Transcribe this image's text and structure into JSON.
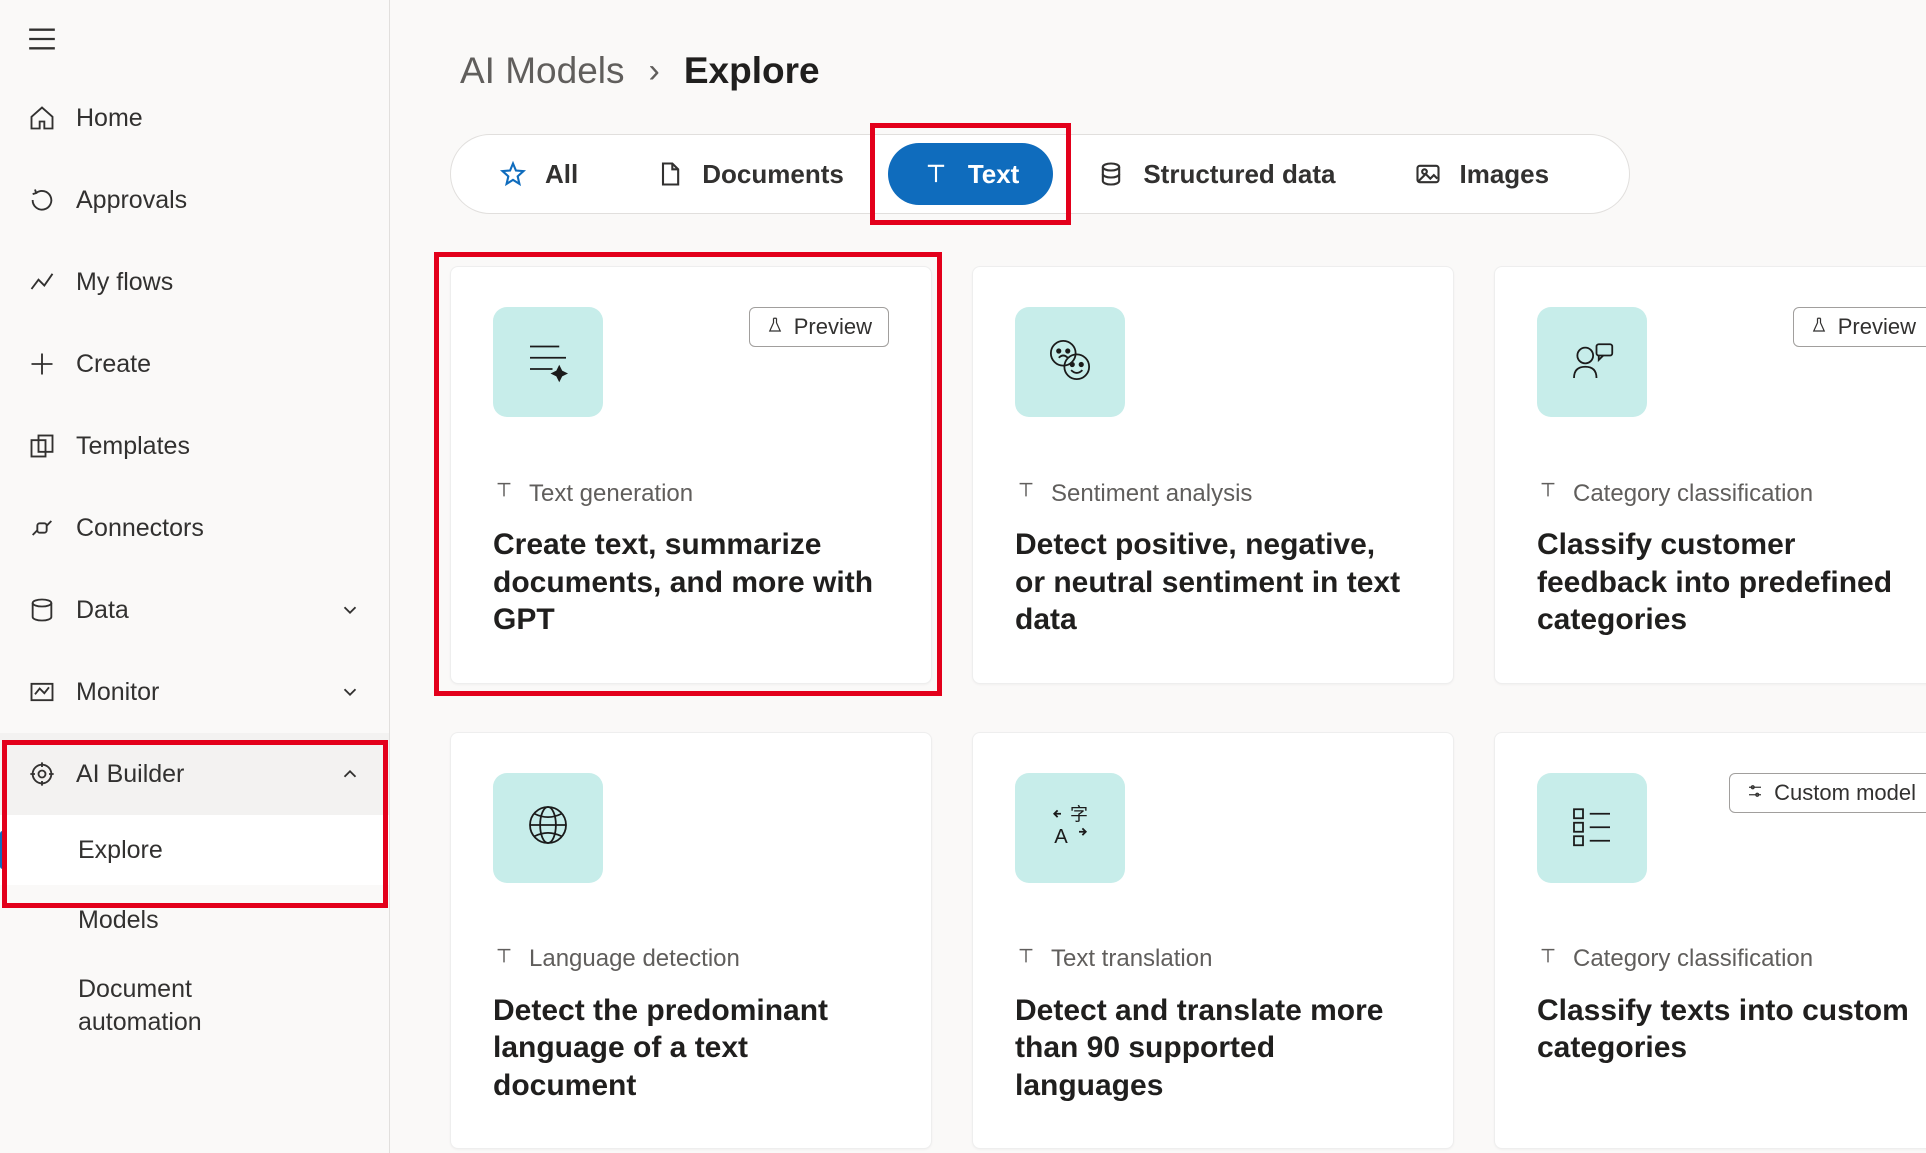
{
  "sidebar": {
    "items": [
      {
        "label": "Home"
      },
      {
        "label": "Approvals"
      },
      {
        "label": "My flows"
      },
      {
        "label": "Create"
      },
      {
        "label": "Templates"
      },
      {
        "label": "Connectors"
      },
      {
        "label": "Data"
      },
      {
        "label": "Monitor"
      },
      {
        "label": "AI Builder"
      }
    ],
    "aiBuilderChildren": [
      {
        "label": "Explore"
      },
      {
        "label": "Models"
      },
      {
        "label": "Document automation"
      }
    ]
  },
  "breadcrumb": {
    "parent": "AI Models",
    "current": "Explore"
  },
  "filters": {
    "all": "All",
    "documents": "Documents",
    "text": "Text",
    "structured": "Structured data",
    "images": "Images"
  },
  "badges": {
    "preview": "Preview",
    "custom": "Custom model"
  },
  "cards": [
    {
      "category": "Text generation",
      "title": "Create text, summarize documents, and more with GPT",
      "badge": "preview",
      "icon": "sparkle-lines"
    },
    {
      "category": "Sentiment analysis",
      "title": "Detect positive, negative, or neutral sentiment in text data",
      "badge": null,
      "icon": "faces"
    },
    {
      "category": "Category classification",
      "title": "Classify customer feedback into predefined categories",
      "badge": "preview",
      "icon": "person-chat"
    },
    {
      "category": "Language detection",
      "title": "Detect the predominant language of a text document",
      "badge": null,
      "icon": "globe"
    },
    {
      "category": "Text translation",
      "title": "Detect and translate more than 90 supported languages",
      "badge": null,
      "icon": "translate"
    },
    {
      "category": "Category classification",
      "title": "Classify texts into custom categories",
      "badge": "custom",
      "icon": "list-box"
    }
  ]
}
